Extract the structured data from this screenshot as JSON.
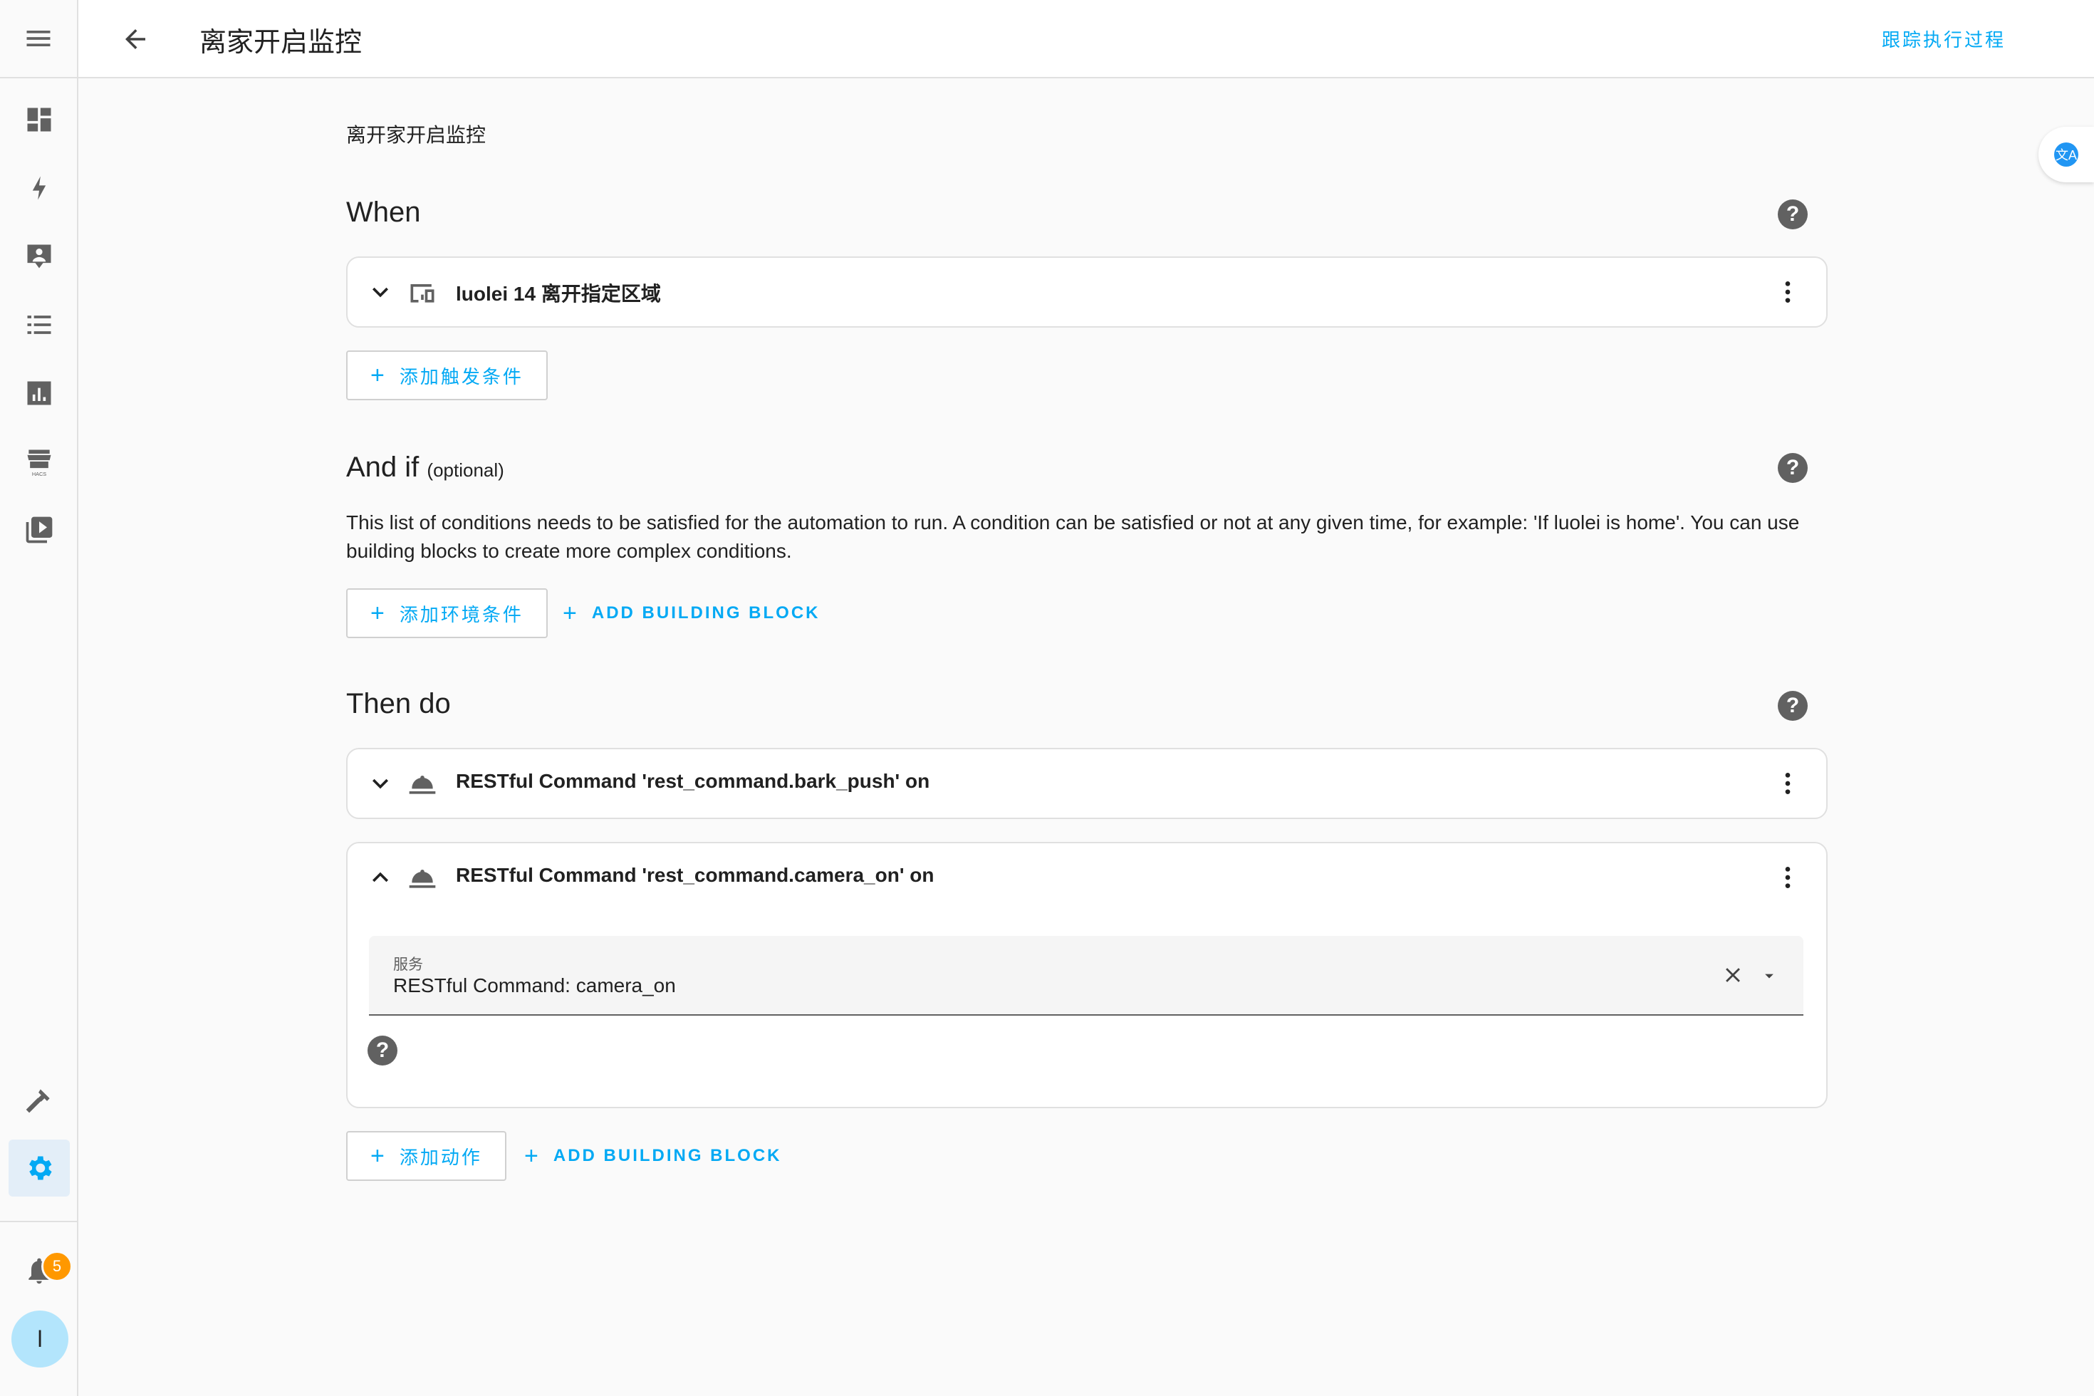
{
  "topbar": {
    "title": "离家开启监控",
    "trace_label": "跟踪执行过程"
  },
  "sidebar": {
    "items": [
      {
        "icon": "dashboard-icon"
      },
      {
        "icon": "energy-icon"
      },
      {
        "icon": "logbook-icon"
      },
      {
        "icon": "todo-list-icon"
      },
      {
        "icon": "history-icon"
      },
      {
        "icon": "hacs-icon"
      },
      {
        "icon": "media-icon"
      },
      {
        "icon": "developer-tools-icon"
      },
      {
        "icon": "settings-icon",
        "active": true
      }
    ],
    "notifications_count": "5",
    "user_initial": "l"
  },
  "translate_icon": "文A",
  "automation": {
    "description": "离开家开启监控",
    "when": {
      "heading": "When",
      "triggers": [
        {
          "label": "luolei 14 离开指定区域",
          "icon": "device-icon"
        }
      ],
      "add_trigger_label": "添加触发条件"
    },
    "and_if": {
      "heading": "And if",
      "optional": "(optional)",
      "description": "This list of conditions needs to be satisfied for the automation to run. A condition can be satisfied or not at any given time, for example: 'If luolei is home'. You can use building blocks to create more complex conditions.",
      "add_condition_label": "添加环境条件",
      "add_block_label": "ADD BUILDING BLOCK"
    },
    "then_do": {
      "heading": "Then do",
      "actions": [
        {
          "label": "RESTful Command 'rest_command.bark_push' on",
          "icon": "service-bell-icon",
          "expanded": false
        },
        {
          "label": "RESTful Command 'rest_command.camera_on' on",
          "icon": "service-bell-icon",
          "expanded": true,
          "service_field": {
            "label": "服务",
            "value": "RESTful Command: camera_on"
          }
        }
      ],
      "add_action_label": "添加动作",
      "add_block_label": "ADD BUILDING BLOCK"
    }
  }
}
